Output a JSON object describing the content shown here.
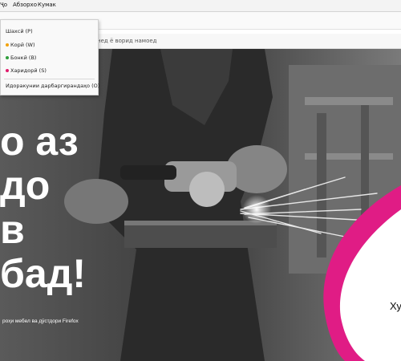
{
  "menubar": {
    "items": [
      "Ҷо",
      "Абзорхо",
      "Кумак"
    ]
  },
  "urlbar": {
    "hint": "нед ё ворид намоед"
  },
  "dropdown": {
    "items": [
      {
        "label": "Шахсӣ (P)"
      },
      {
        "label": "Корӣ (W)",
        "color": "#f2a20c"
      },
      {
        "label": "Бонкӣ (B)",
        "color": "#2e9e3b"
      },
      {
        "label": "Харидорӣ (S)",
        "color": "#e01c6c"
      }
    ],
    "manage": "Идоракунии дарбаргирандаҳо (O)"
  },
  "hero": {
    "headline": [
      "о аз",
      "до",
      "в",
      "бад!"
    ],
    "caption": "роҳи мебел ва дӯстдори Firefox",
    "cta": "Ху"
  },
  "colors": {
    "accent_pink": "#e01c85",
    "photo_tone": "#4a4a4a"
  }
}
